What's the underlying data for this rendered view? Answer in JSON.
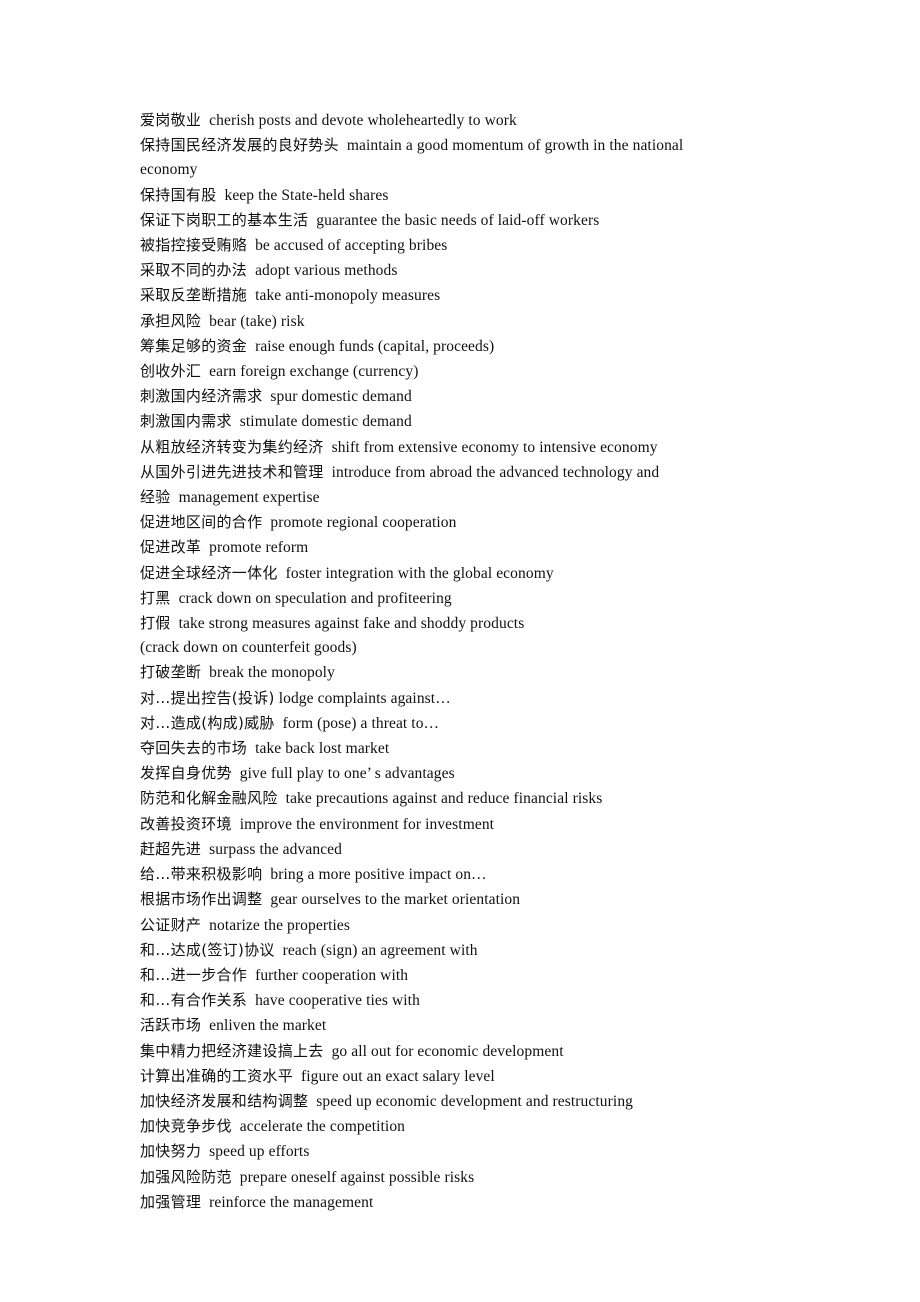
{
  "document": {
    "type": "chinese-english-glossary",
    "page_background": "#ffffff",
    "text_color": "#111111",
    "entries": [
      {
        "cn": "爱岗敬业",
        "sep": "wide",
        "en": "cherish posts and devote wholeheartedly to work"
      },
      {
        "cn": "保持国民经济发展的良好势头",
        "sep": "wide",
        "en": "maintain a good momentum of growth in the national economy"
      },
      {
        "cn": "保持国有股",
        "sep": "wide",
        "en": "keep the State-held shares"
      },
      {
        "cn": "保证下岗职工的基本生活",
        "sep": "wide",
        "en": "guarantee the basic needs of laid-off workers"
      },
      {
        "cn": "被指控接受贿赂",
        "sep": "wide",
        "en": "be accused of accepting bribes"
      },
      {
        "cn": "采取不同的办法",
        "sep": "wide",
        "en": "adopt various methods"
      },
      {
        "cn": "采取反垄断措施",
        "sep": "wide",
        "en": "take anti-monopoly measures"
      },
      {
        "cn": "承担风险",
        "sep": "wide",
        "en": "bear (take) risk"
      },
      {
        "cn": "筹集足够的资金",
        "sep": "wide",
        "en": "raise enough funds (capital, proceeds)"
      },
      {
        "cn": "创收外汇",
        "sep": "wide",
        "en": "earn foreign exchange (currency)"
      },
      {
        "cn": "刺激国内经济需求",
        "sep": "wide",
        "en": "spur domestic demand"
      },
      {
        "cn": "刺激国内需求",
        "sep": "wide",
        "en": "stimulate domestic demand"
      },
      {
        "cn": "从粗放经济转变为集约经济",
        "sep": "wide",
        "en": "shift from extensive economy to intensive economy"
      },
      {
        "cn": "从国外引进先进技术和管理",
        "sep": "wide",
        "en": "introduce from abroad the advanced technology and"
      },
      {
        "cn": "经验",
        "sep": "wide",
        "en": "management expertise"
      },
      {
        "cn": "促进地区间的合作",
        "sep": "wide",
        "en": "promote regional cooperation"
      },
      {
        "cn": "促进改革",
        "sep": "wide",
        "en": "promote reform"
      },
      {
        "cn": "促进全球经济一体化",
        "sep": "wide",
        "en": "foster integration with the global economy"
      },
      {
        "cn": "打黑",
        "sep": "wide",
        "en": "crack down on speculation and profiteering"
      },
      {
        "cn": "打假",
        "sep": "wide",
        "en": "take strong measures against fake and shoddy products"
      },
      {
        "cn": "",
        "sep": "none",
        "en": "(crack down on counterfeit goods)"
      },
      {
        "cn": "打破垄断",
        "sep": "wide",
        "en": "break the monopoly"
      },
      {
        "cn": "对…提出控告(投诉)",
        "sep": "narrow",
        "en": "lodge complaints against…"
      },
      {
        "cn": "对…造成(构成)威胁",
        "sep": "wide",
        "en": "form (pose) a threat to…"
      },
      {
        "cn": "夺回失去的市场",
        "sep": "wide",
        "en": "take back lost market"
      },
      {
        "cn": "发挥自身优势",
        "sep": "wide",
        "en": "give full play to one’ s advantages"
      },
      {
        "cn": "防范和化解金融风险",
        "sep": "wide",
        "en": "take precautions against and reduce financial risks"
      },
      {
        "cn": "改善投资环境",
        "sep": "wide",
        "en": "improve the environment for investment"
      },
      {
        "cn": "赶超先进",
        "sep": "wide",
        "en": "surpass the advanced"
      },
      {
        "cn": "给…带来积极影响",
        "sep": "wide",
        "en": "bring a more positive impact on…"
      },
      {
        "cn": "根据市场作出调整",
        "sep": "wide",
        "en": "gear ourselves to the market orientation"
      },
      {
        "cn": "公证财产",
        "sep": "wide",
        "en": "notarize the properties"
      },
      {
        "cn": "和…达成(签订)协议",
        "sep": "wide",
        "en": "reach (sign) an agreement with"
      },
      {
        "cn": "和…进一步合作",
        "sep": "wide",
        "en": "further cooperation with"
      },
      {
        "cn": "和…有合作关系",
        "sep": "wide",
        "en": "have cooperative ties with"
      },
      {
        "cn": "活跃市场",
        "sep": "wide",
        "en": "enliven the market"
      },
      {
        "cn": "集中精力把经济建设搞上去",
        "sep": "wide",
        "en": "go all out for economic development"
      },
      {
        "cn": "计算出准确的工资水平",
        "sep": "wide",
        "en": "figure out an exact salary level"
      },
      {
        "cn": "加快经济发展和结构调整",
        "sep": "wide",
        "en": "speed up economic development and restructuring"
      },
      {
        "cn": "加快竞争步伐",
        "sep": "wide",
        "en": "accelerate the competition"
      },
      {
        "cn": "加快努力",
        "sep": "wide",
        "en": "speed up efforts"
      },
      {
        "cn": "加强风险防范",
        "sep": "wide",
        "en": "prepare oneself against possible risks"
      },
      {
        "cn": "加强管理",
        "sep": "wide",
        "en": "reinforce the management"
      }
    ]
  }
}
